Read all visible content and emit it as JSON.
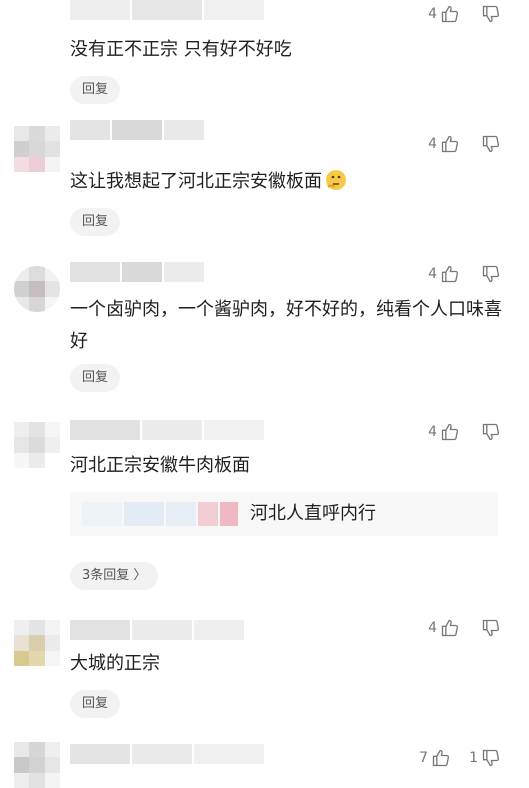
{
  "comments": [
    {
      "text": "没有正不正宗 只有好不好吃",
      "likes": "4",
      "dislikes": "",
      "reply_label": "回复"
    },
    {
      "text": "这让我想起了河北正宗安徽板面",
      "likes": "4",
      "dislikes": "",
      "reply_label": "回复",
      "emoji": "thinking-face"
    },
    {
      "text": "一个卤驴肉，一个酱驴肉，好不好的，纯看个人口味喜好",
      "likes": "4",
      "dislikes": "",
      "reply_label": "回复"
    },
    {
      "text": "河北正宗安徽牛肉板面",
      "likes": "4",
      "dislikes": "",
      "reply_label": "3条回复 〉",
      "sub_reply": {
        "text": "河北人直呼内行"
      }
    },
    {
      "text": "大城的正宗",
      "likes": "4",
      "dislikes": "",
      "reply_label": "回复"
    },
    {
      "text": "",
      "likes": "7",
      "dislikes": "1",
      "reply_label": ""
    }
  ],
  "colors": {
    "text": "#1f1f1f",
    "meta": "#777777",
    "reply_bg": "#f2f2f2"
  }
}
